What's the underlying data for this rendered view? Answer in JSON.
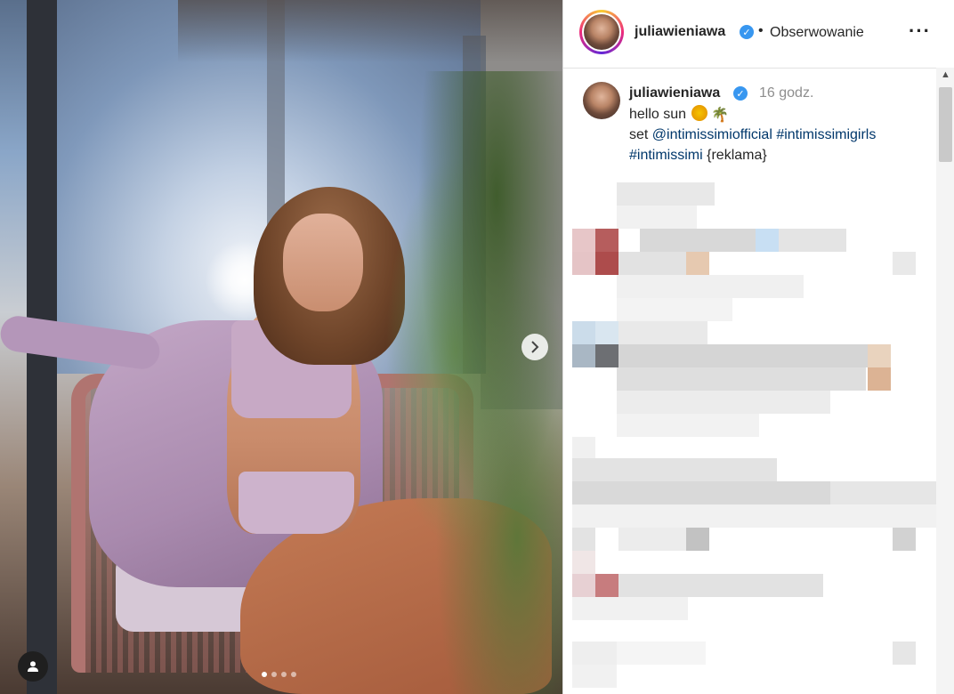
{
  "post": {
    "photo": {
      "carousel_total": 4,
      "carousel_active": 1,
      "next_icon": "chevron-right-icon",
      "tag_icon": "user-icon"
    },
    "header": {
      "username": "juliawieniawa",
      "verified_icon": "verified-badge-icon",
      "separator": "•",
      "follow_label": "Obserwowanie",
      "more_label": "···"
    },
    "caption": {
      "username": "juliawieniawa",
      "time": "16 godz.",
      "line1": "hello sun",
      "line2_prefix": "set",
      "mention": "@intimissimiofficial",
      "hashtag1": "#intimissimigirls",
      "hashtag2": "#intimissimi",
      "suffix": "{reklama}"
    },
    "comments_redacted": true
  },
  "colors": {
    "text": "#262626",
    "muted": "#8e8e8e",
    "link": "#00376b",
    "verified": "#3897f0"
  }
}
